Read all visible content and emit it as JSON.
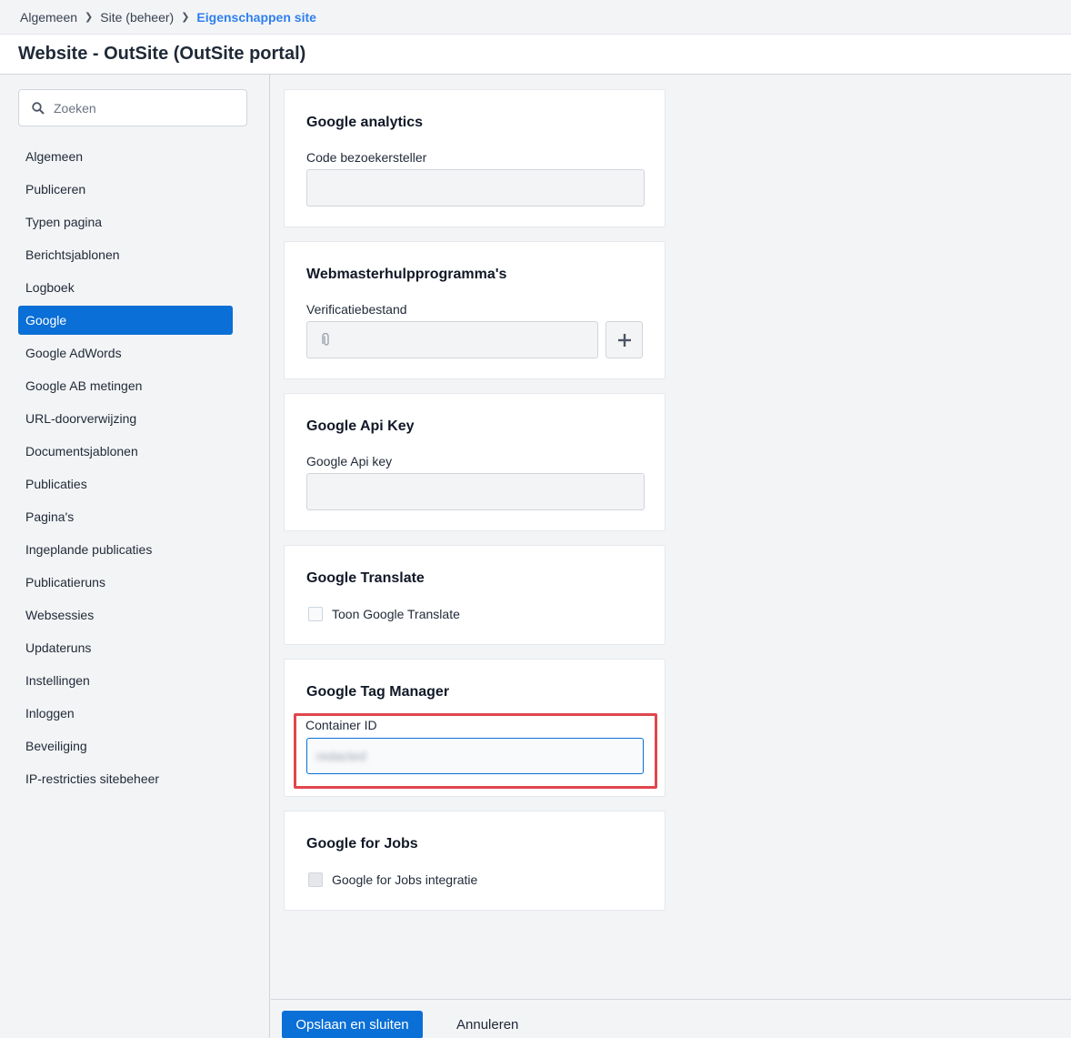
{
  "breadcrumb": {
    "items": [
      "Algemeen",
      "Site (beheer)",
      "Eigenschappen site"
    ]
  },
  "page": {
    "title": "Website - OutSite (OutSite portal)"
  },
  "sidebar": {
    "search_placeholder": "Zoeken",
    "items": [
      {
        "label": "Algemeen"
      },
      {
        "label": "Publiceren"
      },
      {
        "label": "Typen pagina"
      },
      {
        "label": "Berichtsjablonen"
      },
      {
        "label": "Logboek"
      },
      {
        "label": "Google",
        "selected": true
      },
      {
        "label": "Google AdWords"
      },
      {
        "label": "Google AB metingen"
      },
      {
        "label": "URL-doorverwijzing"
      },
      {
        "label": "Documentsjablonen"
      },
      {
        "label": "Publicaties"
      },
      {
        "label": "Pagina's"
      },
      {
        "label": "Ingeplande publicaties"
      },
      {
        "label": "Publicatieruns"
      },
      {
        "label": "Websessies"
      },
      {
        "label": "Updateruns"
      },
      {
        "label": "Instellingen"
      },
      {
        "label": "Inloggen"
      },
      {
        "label": "Beveiliging"
      },
      {
        "label": "IP-restricties sitebeheer"
      }
    ]
  },
  "cards": {
    "analytics": {
      "title": "Google analytics",
      "field_label": "Code bezoekersteller",
      "value": ""
    },
    "webmaster": {
      "title": "Webmasterhulpprogramma's",
      "field_label": "Verificatiebestand",
      "value": ""
    },
    "apikey": {
      "title": "Google Api Key",
      "field_label": "Google Api key",
      "value": ""
    },
    "translate": {
      "title": "Google Translate",
      "checkbox_label": "Toon Google Translate",
      "checked": false
    },
    "tagmanager": {
      "title": "Google Tag Manager",
      "field_label": "Container ID",
      "value": "redacted"
    },
    "jobs": {
      "title": "Google for Jobs",
      "checkbox_label": "Google for Jobs integratie",
      "checked": false
    }
  },
  "footer": {
    "save_label": "Opslaan en sluiten",
    "cancel_label": "Annuleren"
  },
  "colors": {
    "accent": "#0a6fd6",
    "breadcrumb_active": "#2f80ed",
    "highlight": "#e0464e"
  }
}
